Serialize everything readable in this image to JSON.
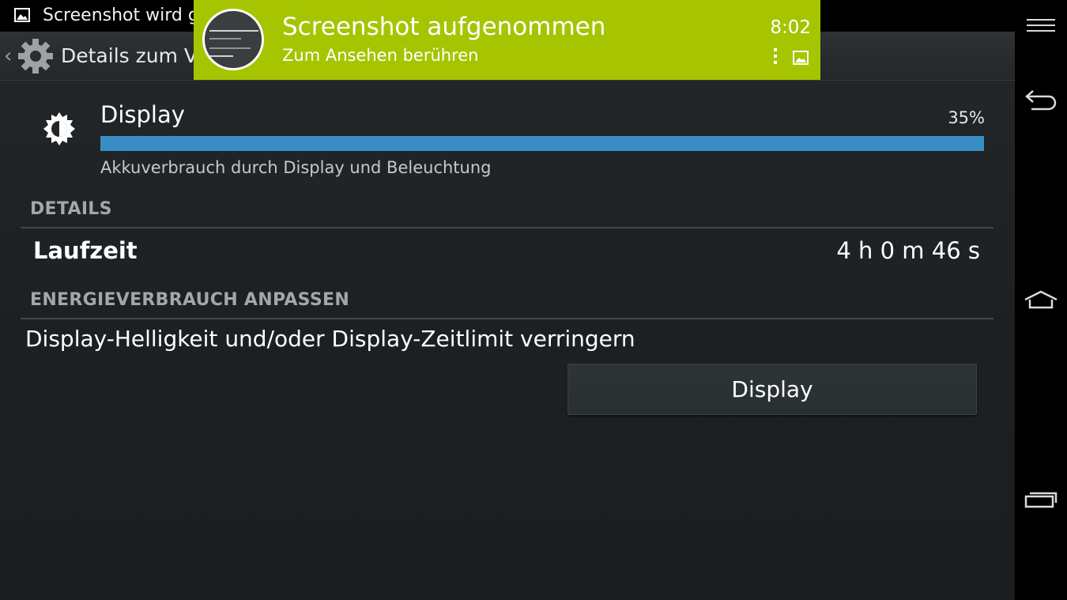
{
  "status_bar": {
    "notification_text": "Screenshot wird g",
    "image_icon": "image-icon"
  },
  "action_bar": {
    "title": "Details zum V",
    "up_icon": "chevron-left-icon",
    "app_icon": "settings-gear-icon"
  },
  "usage": {
    "icon": "brightness-icon",
    "label": "Display",
    "percent_text": "35%",
    "percent_value": 35,
    "description": "Akkuverbrauch durch Display und Beleuchtung",
    "bar_color": "#3a8dc4"
  },
  "details": {
    "header": "DETAILS",
    "rows": [
      {
        "label": "Laufzeit",
        "value": "4 h 0 m 46 s"
      }
    ]
  },
  "adjust": {
    "header": "ENERGIEVERBRAUCH ANPASSEN",
    "tip": "Display-Helligkeit und/oder Display-Zeitlimit verringern",
    "button_label": "Display"
  },
  "notification": {
    "title": "Screenshot aufgenommen",
    "subtitle": "Zum Ansehen berühren",
    "time": "8:02",
    "background_color": "#a6c400",
    "icons": [
      "more-vert-icon",
      "image-icon"
    ]
  },
  "nav_bar": {
    "buttons": [
      "menu-icon",
      "back-icon",
      "home-icon",
      "recents-icon"
    ]
  }
}
